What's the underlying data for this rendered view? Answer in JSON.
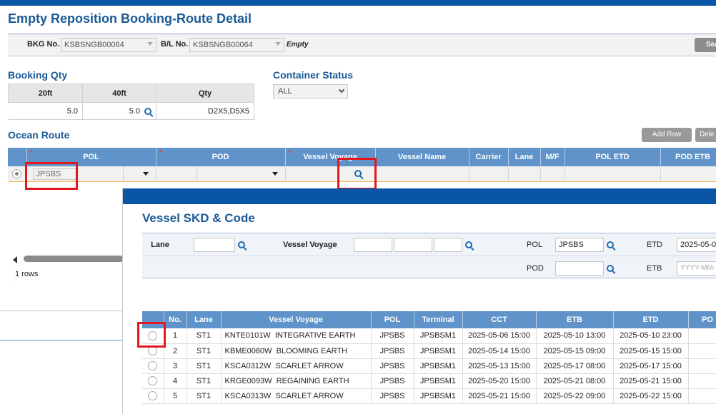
{
  "page": {
    "title": "Empty Reposition Booking-Route Detail"
  },
  "search": {
    "bkg_label": "BKG No.",
    "bkg_value": "KSBSNGB00064",
    "bl_label": "B/L No.",
    "bl_value": "KSBSNGB00064",
    "type_text": "Empty",
    "search_button": "Sea"
  },
  "booking_qty": {
    "heading": "Booking Qty",
    "headers": [
      "20ft",
      "40ft",
      "Qty"
    ],
    "values": {
      "ft20": "5.0",
      "ft40": "5.0",
      "qty": "D2X5,D5X5"
    }
  },
  "container_status": {
    "heading": "Container Status",
    "selected": "ALL"
  },
  "ocean_route": {
    "heading": "Ocean Route",
    "add_row_label": "Add Row",
    "delete_label": "Dele",
    "headers": [
      "POL",
      "POD",
      "Vessel Voyage",
      "Vessel Name",
      "Carrier",
      "Lane",
      "M/F",
      "POL ETD",
      "POD ETB"
    ],
    "row": {
      "pol": "JPSBS"
    },
    "rows_count": "1 rows"
  },
  "popup": {
    "title": "Vessel SKD & Code",
    "lane_label": "Lane",
    "vessel_voyage_label": "Vessel Voyage",
    "pol_label": "POL",
    "pol_value": "JPSBS",
    "pod_label": "POD",
    "etd_label": "ETD",
    "etd_value": "2025-05-0",
    "etb_label": "ETB",
    "etb_placeholder": "YYYY-MM-D",
    "table_headers": [
      "No.",
      "Lane",
      "Vessel Voyage",
      "POL",
      "Terminal",
      "CCT",
      "ETB",
      "ETD",
      "PO"
    ],
    "rows": [
      {
        "no": "1",
        "lane": "ST1",
        "voyage": "KNTE0101W",
        "vessel": "INTEGRATIVE EARTH",
        "pol": "JPSBS",
        "terminal": "JPSBSM1",
        "cct": "2025-05-06 15:00",
        "etb": "2025-05-10 13:00",
        "etd": "2025-05-10 23:00"
      },
      {
        "no": "2",
        "lane": "ST1",
        "voyage": "KBME0080W",
        "vessel": "BLOOMING EARTH",
        "pol": "JPSBS",
        "terminal": "JPSBSM1",
        "cct": "2025-05-14 15:00",
        "etb": "2025-05-15 09:00",
        "etd": "2025-05-15 15:00"
      },
      {
        "no": "3",
        "lane": "ST1",
        "voyage": "KSCA0312W",
        "vessel": "SCARLET ARROW",
        "pol": "JPSBS",
        "terminal": "JPSBSM1",
        "cct": "2025-05-13 15:00",
        "etb": "2025-05-17 08:00",
        "etd": "2025-05-17 15:00"
      },
      {
        "no": "4",
        "lane": "ST1",
        "voyage": "KRGE0093W",
        "vessel": "REGAINING EARTH",
        "pol": "JPSBS",
        "terminal": "JPSBSM1",
        "cct": "2025-05-20 15:00",
        "etb": "2025-05-21 08:00",
        "etd": "2025-05-21 15:00"
      },
      {
        "no": "5",
        "lane": "ST1",
        "voyage": "KSCA0313W",
        "vessel": "SCARLET ARROW",
        "pol": "JPSBS",
        "terminal": "JPSBSM1",
        "cct": "2025-05-21 15:00",
        "etb": "2025-05-22 09:00",
        "etd": "2025-05-22 15:00"
      }
    ]
  },
  "colors": {
    "brand_blue": "#0a55a5",
    "header_blue": "#5f93c9",
    "title_blue": "#1a5a96",
    "highlight_red": "#e1191e"
  }
}
